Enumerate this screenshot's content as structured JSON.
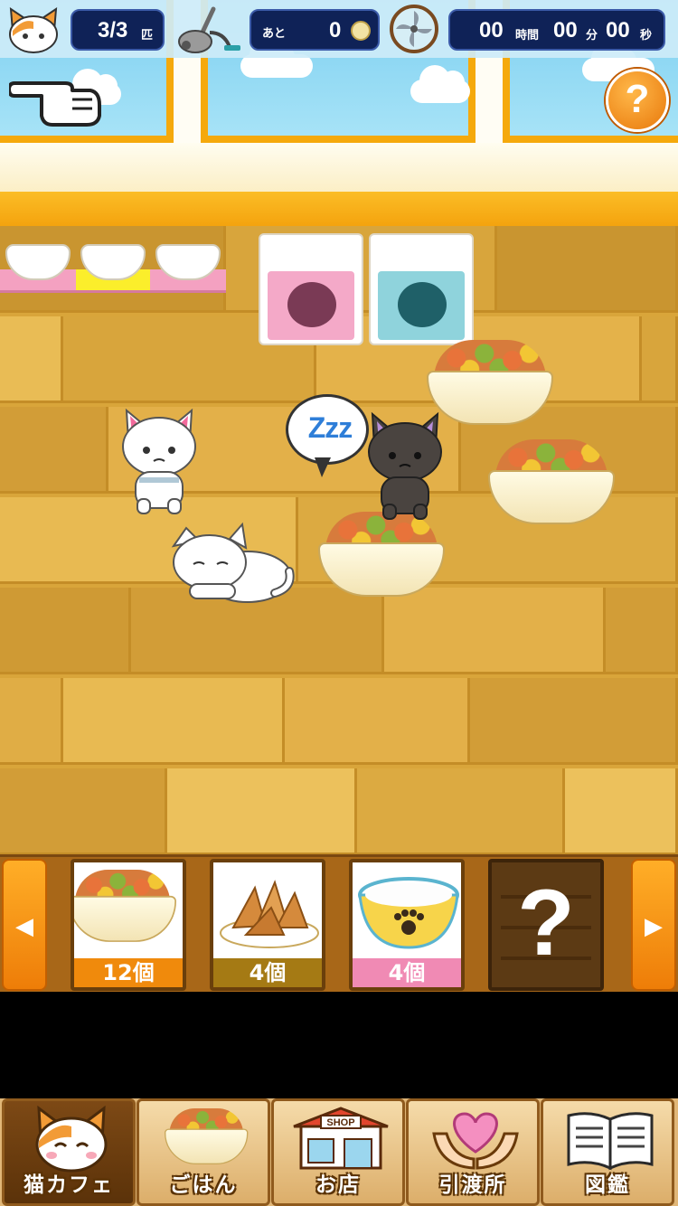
{
  "hud": {
    "cat_count": "3/3",
    "cat_unit": "匹",
    "remaining_label": "あと",
    "remaining_value": "0",
    "timer_hours": "00",
    "timer_hours_unit": "時間",
    "timer_minutes": "00",
    "timer_minutes_unit": "分",
    "timer_seconds": "00",
    "timer_seconds_unit": "秒",
    "help_symbol": "?"
  },
  "bubble": {
    "text": "Zzz"
  },
  "tray": {
    "left_arrow": "◀",
    "right_arrow": "▶",
    "items": [
      {
        "name": "kibble-bowl",
        "count": "12個",
        "count_color": "#f08a0c"
      },
      {
        "name": "dried-fish",
        "count": "4個",
        "count_color": "#a57a14"
      },
      {
        "name": "milk-bowl",
        "count": "4個",
        "count_color": "#f08ab4"
      },
      {
        "name": "locked-item",
        "symbol": "?"
      }
    ]
  },
  "nav": [
    {
      "label": "猫カフェ",
      "icon": "cat-face-icon",
      "active": true
    },
    {
      "label": "ごはん",
      "icon": "food-bowl-icon",
      "active": false
    },
    {
      "label": "お店",
      "icon": "shop-icon",
      "shop_sign": "SHOP",
      "active": false
    },
    {
      "label": "引渡所",
      "icon": "heart-hands-icon",
      "active": false
    },
    {
      "label": "図鑑",
      "icon": "book-icon",
      "active": false
    }
  ],
  "colors": {
    "hud_bg": "#0f2257",
    "accent_orange": "#f5a90c",
    "floor": "#d9a53a",
    "nav_active": "#6a3c0f"
  }
}
